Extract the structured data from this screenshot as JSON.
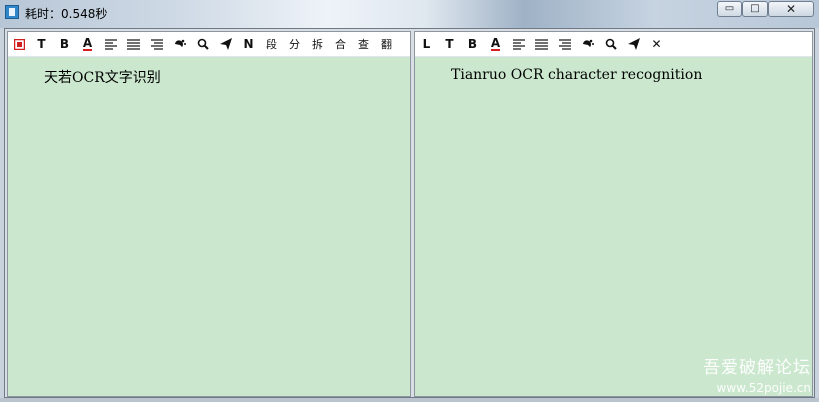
{
  "window": {
    "title": "耗时：0.548秒",
    "minimize_glyph": "▭",
    "maximize_glyph": "□",
    "close_glyph": "✕"
  },
  "left_toolbar": {
    "text_button": "T",
    "bold_button": "B",
    "font_color_button": "A",
    "replace_button": "N",
    "paragraph_button": "段",
    "split_button": "分",
    "break_button": "拆",
    "merge_button": "合",
    "lookup_button": "查",
    "translate_button": "翻"
  },
  "right_toolbar": {
    "layout_button": "L",
    "text_button": "T",
    "bold_button": "B",
    "font_color_button": "A",
    "close_button": "✕"
  },
  "left_pane": {
    "text": "天若OCR文字识别"
  },
  "right_pane": {
    "text": "Tianruo OCR character recognition"
  },
  "watermark": {
    "line1": "吾爱破解论坛",
    "line2": "www.52pojie.cn"
  },
  "colors": {
    "pane_background": "#cbe8cf",
    "toolbar_background": "#ffffff",
    "font_color_underline": "#d42020",
    "stop_icon": "#d02020"
  }
}
